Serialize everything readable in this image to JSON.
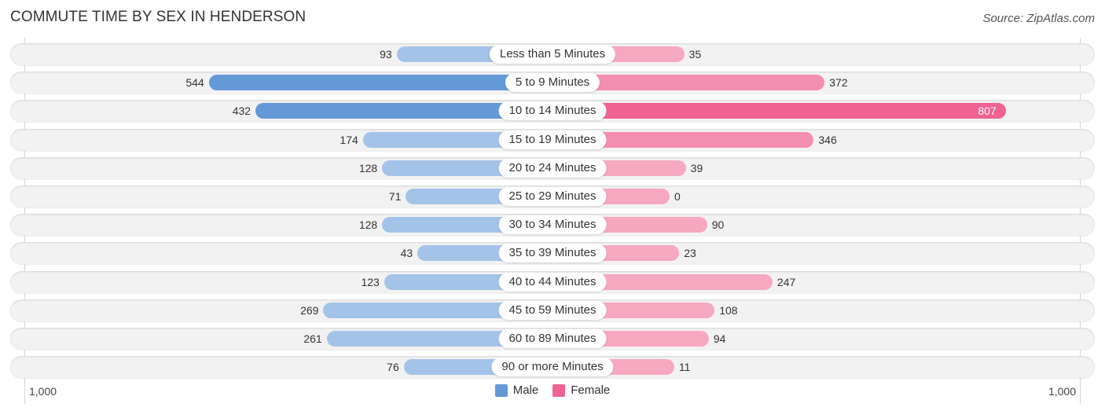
{
  "header": {
    "title": "COMMUTE TIME BY SEX IN HENDERSON",
    "source": "Source: ZipAtlas.com"
  },
  "colors": {
    "male": "#6499d8",
    "male_light": "#a4c3e8",
    "female": "#f06292",
    "female_light": "#f6a8c0"
  },
  "chart_data": {
    "type": "bar",
    "orientation": "horizontal-diverging",
    "title": "COMMUTE TIME BY SEX IN HENDERSON",
    "categories": [
      "Less than 5 Minutes",
      "5 to 9 Minutes",
      "10 to 14 Minutes",
      "15 to 19 Minutes",
      "20 to 24 Minutes",
      "25 to 29 Minutes",
      "30 to 34 Minutes",
      "35 to 39 Minutes",
      "40 to 44 Minutes",
      "45 to 59 Minutes",
      "60 to 89 Minutes",
      "90 or more Minutes"
    ],
    "series": [
      {
        "name": "Male",
        "values": [
          93,
          544,
          432,
          174,
          128,
          71,
          128,
          43,
          123,
          269,
          261,
          76
        ]
      },
      {
        "name": "Female",
        "values": [
          35,
          372,
          807,
          346,
          39,
          0,
          90,
          23,
          247,
          108,
          94,
          11
        ]
      }
    ],
    "xlim": [
      -1000,
      1000
    ],
    "tick_labels": {
      "left": "1,000",
      "right": "1,000"
    },
    "legend": {
      "position": "bottom-center",
      "entries": [
        "Male",
        "Female"
      ]
    },
    "grid": false
  }
}
